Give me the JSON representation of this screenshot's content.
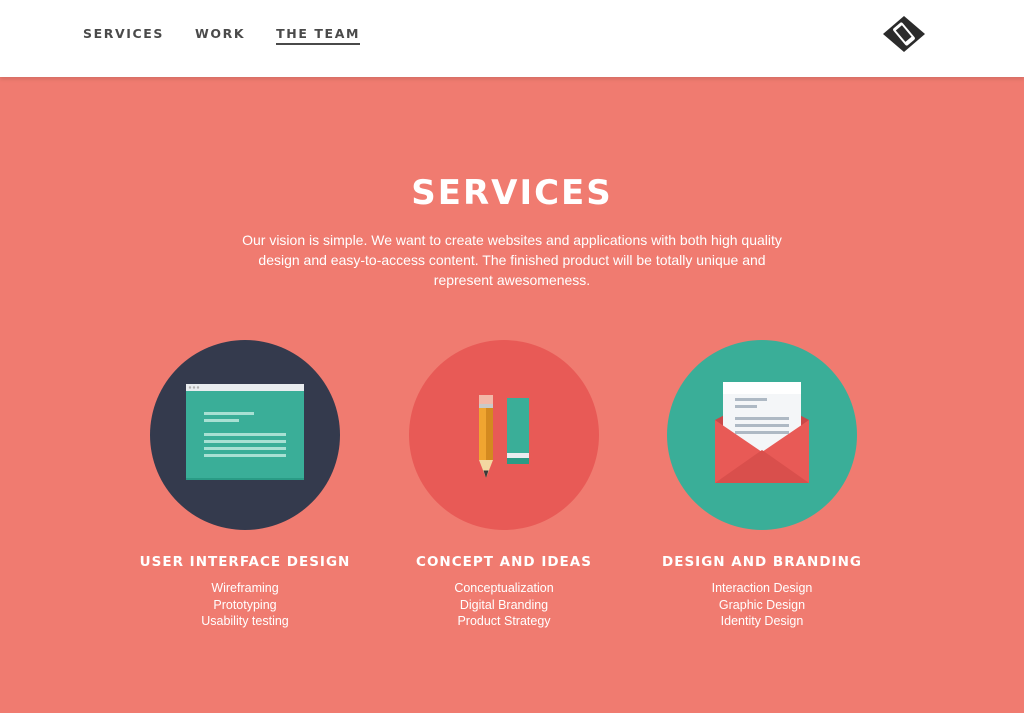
{
  "nav": {
    "items": [
      {
        "label": "SERVICES",
        "name": "nav-services",
        "active": false
      },
      {
        "label": "WORK",
        "name": "nav-work",
        "active": false
      },
      {
        "label": "THE TEAM",
        "name": "nav-the-team",
        "active": true
      }
    ],
    "logo_icon": "diamond-device-logo-icon"
  },
  "section": {
    "title": "SERVICES",
    "intro": "Our vision is simple. We want to create websites and applications with both high quality design and easy-to-access content. The finished product will be totally unique and represent awesomeness."
  },
  "services": [
    {
      "title": "USER INTERFACE DESIGN",
      "icon": "browser-window-icon",
      "circle_color": "#343a4d",
      "items": [
        "Wireframing",
        "Prototyping",
        "Usability testing"
      ]
    },
    {
      "title": "CONCEPT AND IDEAS",
      "icon": "pencil-and-eraser-icon",
      "circle_color": "#e85a56",
      "items": [
        "Conceptualization",
        "Digital Branding",
        "Product Strategy"
      ]
    },
    {
      "title": "DESIGN AND BRANDING",
      "icon": "envelope-letter-icon",
      "circle_color": "#3aae98",
      "items": [
        "Interaction Design",
        "Graphic Design",
        "Identity Design"
      ]
    }
  ],
  "colors": {
    "background": "#f07b70",
    "nav_text": "#4a4a4a",
    "text": "#ffffff"
  }
}
